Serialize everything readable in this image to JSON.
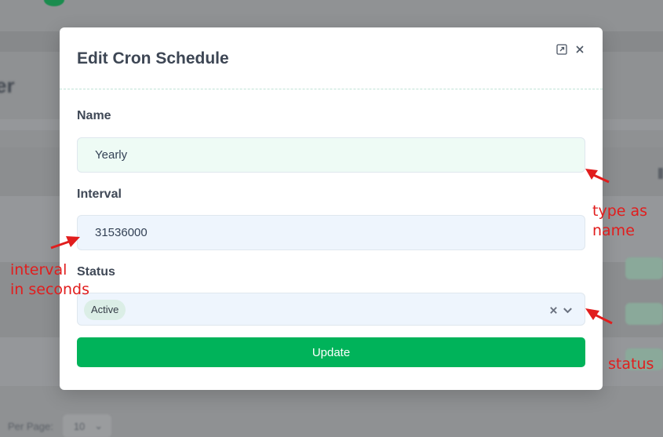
{
  "modal": {
    "title": "Edit Cron Schedule",
    "fields": {
      "name": {
        "label": "Name",
        "value": "Yearly"
      },
      "interval": {
        "label": "Interval",
        "value": "31536000"
      },
      "status": {
        "label": "Status",
        "selected": "Active"
      }
    },
    "update_label": "Update"
  },
  "annotations": {
    "name_note_line1": "type as",
    "name_note_line2": "name",
    "interval_note_line1": "interval",
    "interval_note_line2": "in seconds",
    "status_note": "status"
  },
  "icons": {
    "expand": "expand-icon",
    "close": "close-icon",
    "clear": "clear-icon",
    "chevron": "chevron-down-icon"
  },
  "colors": {
    "primary_button": "#00b35a",
    "annotation": "#e11d1d",
    "name_input_bg": "#eefbf5",
    "input_bg": "#eef5fd"
  }
}
